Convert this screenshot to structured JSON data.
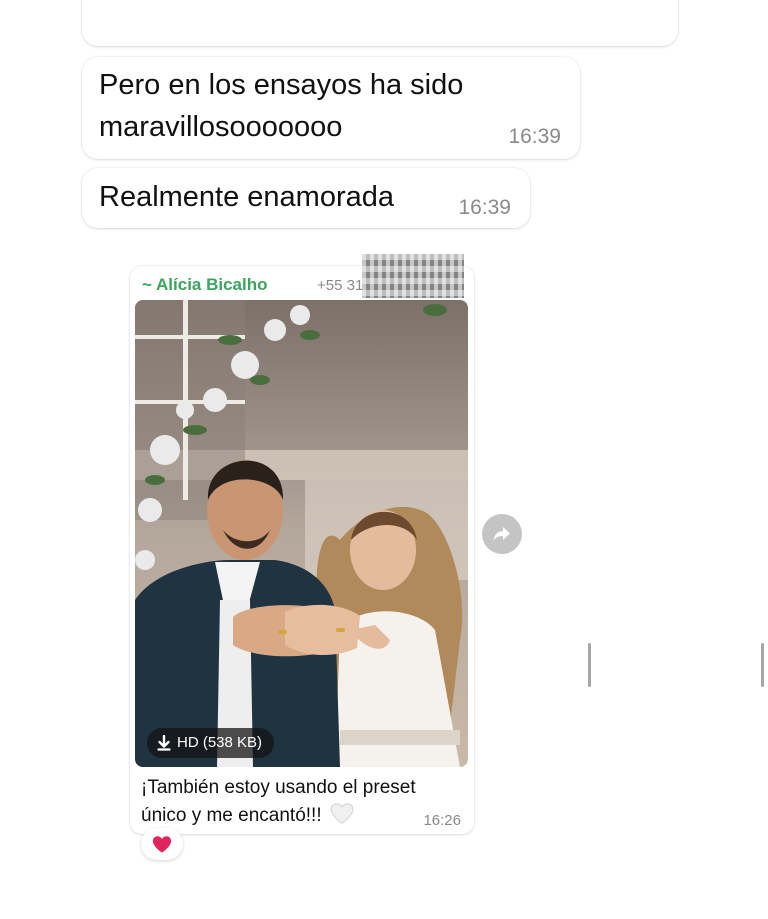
{
  "messages": [
    {
      "text": "Pero en los ensayos ha sido maravillosooooooo",
      "time": "16:39"
    },
    {
      "text": "Realmente enamorada",
      "time": "16:39"
    }
  ],
  "media_message": {
    "sender": "~ Alícia Bicalho",
    "phone": "+55 31",
    "download_label": "HD (538 KB)",
    "caption": "¡También estoy usando el preset único y me encantó!!!",
    "caption_emoji": "white-heart",
    "time": "16:26",
    "reaction": "red-heart"
  },
  "colors": {
    "sender": "#3ba55c",
    "timestamp": "#8a8a8a",
    "reaction_heart": "#e0245e"
  },
  "icons": [
    "download-icon",
    "forward-icon",
    "white-heart-icon",
    "red-heart-icon"
  ]
}
